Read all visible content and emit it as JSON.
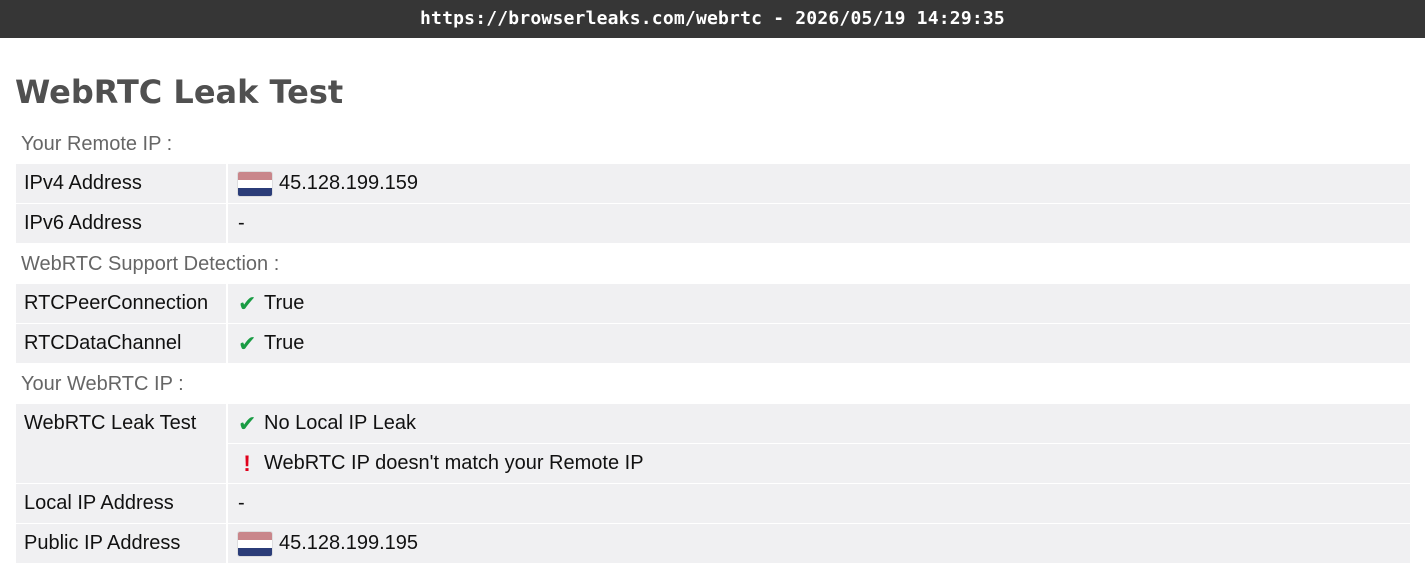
{
  "browser": {
    "url_timestamp": "https://browserleaks.com/webrtc - 2026/05/19 14:29:35"
  },
  "page": {
    "title": "WebRTC Leak Test"
  },
  "colors": {
    "check_green": "#1a9c44",
    "warn_red": "#e0001b",
    "flag_red": "#c9868b",
    "flag_white": "#ffffff",
    "flag_blue": "#2b3c78"
  },
  "remote_ip": {
    "heading": "Your Remote IP :",
    "ipv4_label": "IPv4 Address",
    "ipv4_value": "45.128.199.159",
    "ipv4_flag_icon": "netherlands-flag-icon",
    "ipv6_label": "IPv6 Address",
    "ipv6_value": "-"
  },
  "support": {
    "heading": "WebRTC Support Detection :",
    "rtcpeer_label": "RTCPeerConnection",
    "rtcpeer_value": "True",
    "rtcdata_label": "RTCDataChannel",
    "rtcdata_value": "True",
    "check_glyph": "✔"
  },
  "webrtc_ip": {
    "heading": "Your WebRTC IP :",
    "leak_label": "WebRTC Leak Test",
    "leak_value_1": "No Local IP Leak",
    "leak_value_2": "WebRTC IP doesn't match your Remote IP",
    "warn_glyph": "!",
    "local_label": "Local IP Address",
    "local_value": "-",
    "public_label": "Public IP Address",
    "public_value": "45.128.199.195",
    "public_flag_icon": "netherlands-flag-icon"
  }
}
